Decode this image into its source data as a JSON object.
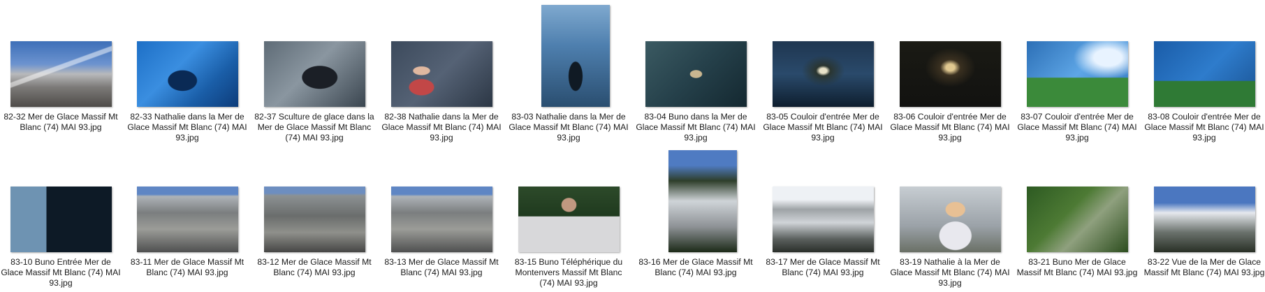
{
  "files": [
    {
      "caption": "82-32 Mer de Glace Massif Mt Blanc (74) MAI 93.jpg",
      "orientation": "landscape",
      "icon": "photo-mountain"
    },
    {
      "caption": "82-33 Nathalie dans la Mer de Glace Massif Mt Blanc (74) MAI 93.jpg",
      "orientation": "landscape",
      "icon": "photo-blue-ice-tunnel"
    },
    {
      "caption": "82-37 Sculture de glace dans la Mer de Glace Massif Mt Blanc (74) MAI 93.jpg",
      "orientation": "landscape",
      "icon": "photo-ice-sculpture"
    },
    {
      "caption": "82-38 Nathalie dans la Mer de Glace Massif Mt Blanc (74) MAI 93.jpg",
      "orientation": "landscape",
      "icon": "photo-person"
    },
    {
      "caption": "83-03 Nathalie dans la Mer de Glace Massif Mt Blanc (74) MAI 93.jpg",
      "orientation": "portrait",
      "icon": "photo-ice-cave"
    },
    {
      "caption": "83-04 Buno dans la Mer de Glace Massif Mt Blanc (74) MAI 93.jpg",
      "orientation": "landscape",
      "icon": "photo-person"
    },
    {
      "caption": "83-05 Couloir d'entrée Mer de Glace Massif Mt Blanc (74) MAI 93.jpg",
      "orientation": "landscape",
      "icon": "photo-corridor"
    },
    {
      "caption": "83-06 Couloir d'entrée Mer de Glace Massif Mt Blanc (74) MAI 93.jpg",
      "orientation": "landscape",
      "icon": "photo-dark-cave"
    },
    {
      "caption": "83-07 Couloir d'entrée Mer de Glace Massif Mt Blanc (74) MAI 93.jpg",
      "orientation": "landscape",
      "icon": "photo-light-corridor"
    },
    {
      "caption": "83-08 Couloir d'entrée Mer de Glace Massif Mt Blanc (74) MAI 93.jpg",
      "orientation": "landscape",
      "icon": "photo-light-corridor"
    },
    {
      "caption": "83-10 Buno Entrée Mer de Glace Massif Mt Blanc (74) MAI 93.jpg",
      "orientation": "landscape",
      "icon": "photo-cave-entry"
    },
    {
      "caption": "83-11 Mer de Glace Massif Mt Blanc (74) MAI 93.jpg",
      "orientation": "landscape",
      "icon": "photo-glacier"
    },
    {
      "caption": "83-12 Mer de Glace Massif Mt Blanc (74) MAI 93.jpg",
      "orientation": "landscape",
      "icon": "photo-glacier"
    },
    {
      "caption": "83-13 Mer de Glace Massif Mt Blanc (74) MAI 93.jpg",
      "orientation": "landscape",
      "icon": "photo-glacier"
    },
    {
      "caption": "83-15 Buno Téléphérique du Montenvers Massif Mt Blanc (74) MAI 93.jpg",
      "orientation": "landscape",
      "icon": "photo-cable-car"
    },
    {
      "caption": "83-16 Mer de Glace Massif Mt Blanc (74) MAI 93.jpg",
      "orientation": "portrait",
      "icon": "photo-valley"
    },
    {
      "caption": "83-17 Mer de Glace Massif Mt Blanc (74) MAI 93.jpg",
      "orientation": "landscape",
      "icon": "photo-valley"
    },
    {
      "caption": "83-19 Nathalie à la Mer de Glace Massif Mt Blanc (74) MAI 93.jpg",
      "orientation": "landscape",
      "icon": "photo-person"
    },
    {
      "caption": "83-21 Buno Mer de Glace Massif Mt Blanc (74) MAI 93.jpg",
      "orientation": "landscape",
      "icon": "photo-hiker"
    },
    {
      "caption": "83-22 Vue de la Mer de Glace Massif Mt Blanc (74) MAI 93.jpg",
      "orientation": "landscape",
      "icon": "photo-snow-peaks"
    }
  ]
}
